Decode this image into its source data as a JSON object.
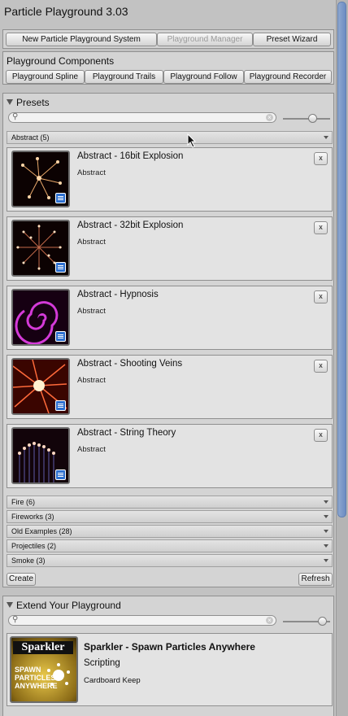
{
  "window": {
    "title": "Particle Playground 3.03"
  },
  "toolbar": {
    "new_system": "New Particle Playground System",
    "manager": "Playground Manager",
    "wizard": "Preset Wizard"
  },
  "components": {
    "heading": "Playground Components",
    "buttons": [
      "Playground Spline",
      "Playground Trails",
      "Playground Follow",
      "Playground Recorder"
    ]
  },
  "presets": {
    "heading": "Presets",
    "slider_level": 0.65,
    "open_category": "Abstract (5)",
    "items": [
      {
        "name": "Abstract - 16bit Explosion",
        "category": "Abstract",
        "remove": "x",
        "thumb": "explosion-thumbnail-icon"
      },
      {
        "name": "Abstract - 32bit Explosion",
        "category": "Abstract",
        "remove": "x",
        "thumb": "burst-thumbnail-icon"
      },
      {
        "name": "Abstract - Hypnosis",
        "category": "Abstract",
        "remove": "x",
        "thumb": "spiral-thumbnail-icon"
      },
      {
        "name": "Abstract - Shooting Veins",
        "category": "Abstract",
        "remove": "x",
        "thumb": "rays-thumbnail-icon"
      },
      {
        "name": "Abstract - String Theory",
        "category": "Abstract",
        "remove": "x",
        "thumb": "strings-thumbnail-icon"
      }
    ],
    "collapsed_categories": [
      "Fire (6)",
      "Fireworks (3)",
      "Old Examples (28)",
      "Projectiles (2)",
      "Smoke (3)"
    ],
    "create": "Create",
    "refresh": "Refresh"
  },
  "extend": {
    "heading": "Extend Your Playground",
    "slider_level": 0.92,
    "product": {
      "title": "Sparkler - Spawn Particles Anywhere",
      "category": "Scripting",
      "publisher": "Cardboard Keep",
      "logo_word": "Sparkler",
      "logo_lines": [
        "SPAWN",
        "PARTICLES",
        "ANYWHERE"
      ]
    }
  },
  "colors": {
    "panel": "#d4d4d4",
    "background": "#c2c2c2",
    "scroll_thumb": "#7b97c8",
    "badge": "#2c6fd0"
  }
}
